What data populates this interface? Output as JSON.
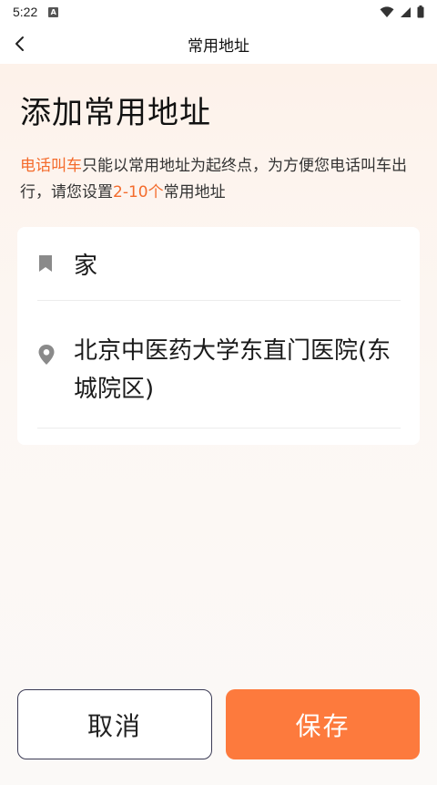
{
  "status_bar": {
    "time": "5:22",
    "notification_letter": "A"
  },
  "nav": {
    "title": "常用地址"
  },
  "page": {
    "heading": "添加常用地址",
    "intro": {
      "highlight_1": "电话叫车",
      "text_1": "只能以常用地址为起终点，为方便您电话叫车出行，请您设置",
      "highlight_2": "2-10个",
      "text_2": "常用地址"
    }
  },
  "form": {
    "name_value": "家",
    "address_value": "北京中医药大学东直门医院(东城院区)"
  },
  "buttons": {
    "cancel_label": "取消",
    "save_label": "保存"
  },
  "colors": {
    "accent": "#f46b2c",
    "save_button": "#fd7a3d",
    "icon_gray": "#8a8a8a"
  },
  "icons": {
    "back": "back-arrow-icon",
    "name": "bookmark-icon",
    "address": "location-pin-icon",
    "wifi": "wifi-icon",
    "signal": "cell-signal-icon",
    "battery": "battery-icon"
  }
}
